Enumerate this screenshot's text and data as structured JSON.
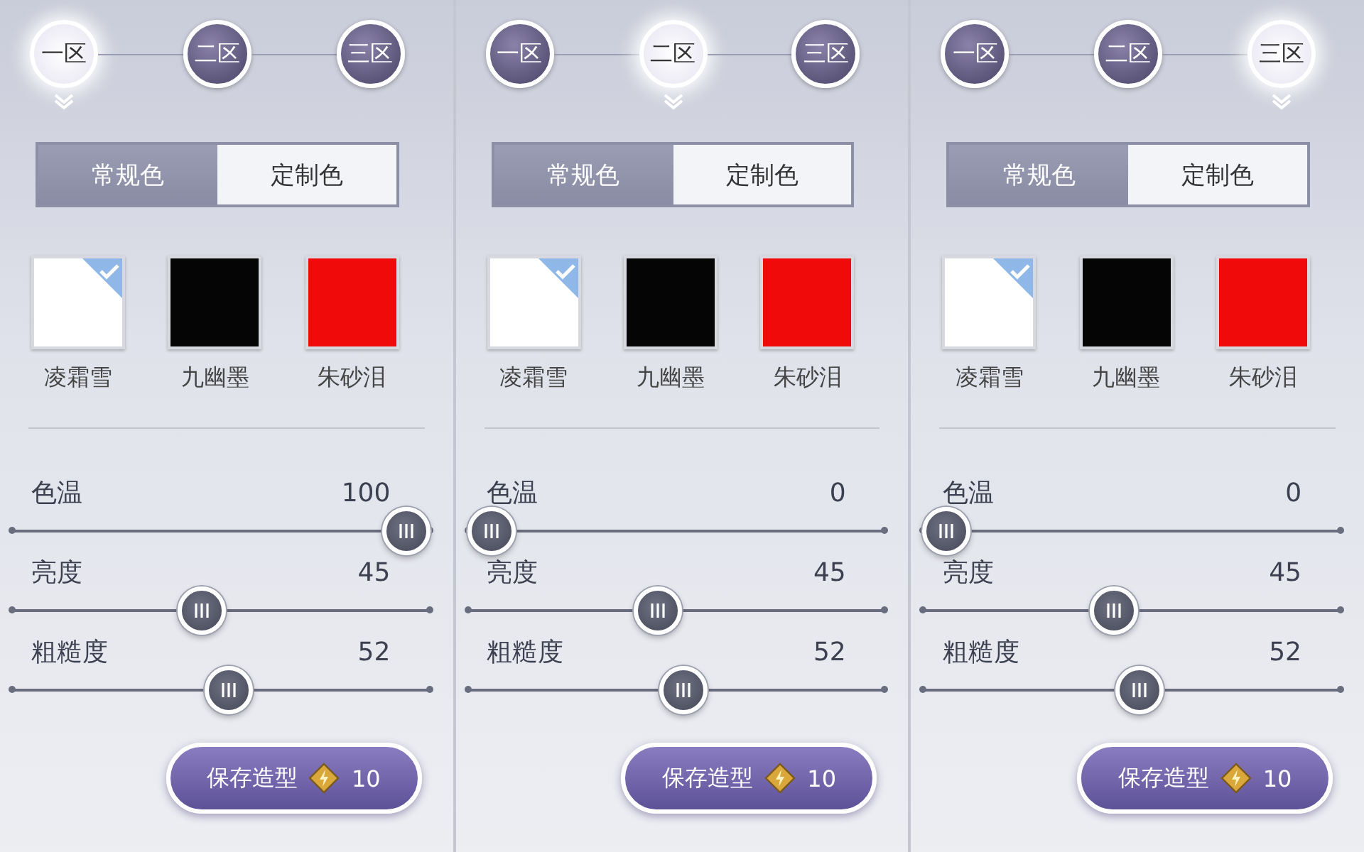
{
  "panels": [
    {
      "zones": [
        {
          "label": "一区",
          "selected": true
        },
        {
          "label": "二区",
          "selected": false
        },
        {
          "label": "三区",
          "selected": false
        }
      ],
      "modes": [
        {
          "label": "常规色",
          "selected": true
        },
        {
          "label": "定制色",
          "selected": false
        }
      ],
      "swatches": [
        {
          "label": "凌霜雪",
          "color": "#ffffff",
          "selected": true
        },
        {
          "label": "九幽墨",
          "color": "#050505",
          "selected": false
        },
        {
          "label": "朱砂泪",
          "color": "#f00a0a",
          "selected": false
        }
      ],
      "sliders": [
        {
          "label": "色温",
          "value": "100",
          "level": 1
        },
        {
          "label": "亮度",
          "value": "45",
          "level": 0.45
        },
        {
          "label": "粗糙度",
          "value": "52",
          "level": 0.52
        }
      ],
      "save": {
        "label": "保存造型",
        "cost": "10"
      }
    },
    {
      "zones": [
        {
          "label": "一区",
          "selected": false
        },
        {
          "label": "二区",
          "selected": true
        },
        {
          "label": "三区",
          "selected": false
        }
      ],
      "modes": [
        {
          "label": "常规色",
          "selected": true
        },
        {
          "label": "定制色",
          "selected": false
        }
      ],
      "swatches": [
        {
          "label": "凌霜雪",
          "color": "#ffffff",
          "selected": true
        },
        {
          "label": "九幽墨",
          "color": "#050505",
          "selected": false
        },
        {
          "label": "朱砂泪",
          "color": "#f00a0a",
          "selected": false
        }
      ],
      "sliders": [
        {
          "label": "色温",
          "value": "0",
          "level": 0
        },
        {
          "label": "亮度",
          "value": "45",
          "level": 0.45
        },
        {
          "label": "粗糙度",
          "value": "52",
          "level": 0.52
        }
      ],
      "save": {
        "label": "保存造型",
        "cost": "10"
      }
    },
    {
      "zones": [
        {
          "label": "一区",
          "selected": false
        },
        {
          "label": "二区",
          "selected": false
        },
        {
          "label": "三区",
          "selected": true
        }
      ],
      "modes": [
        {
          "label": "常规色",
          "selected": true
        },
        {
          "label": "定制色",
          "selected": false
        }
      ],
      "swatches": [
        {
          "label": "凌霜雪",
          "color": "#ffffff",
          "selected": true
        },
        {
          "label": "九幽墨",
          "color": "#050505",
          "selected": false
        },
        {
          "label": "朱砂泪",
          "color": "#f00a0a",
          "selected": false
        }
      ],
      "sliders": [
        {
          "label": "色温",
          "value": "0",
          "level": 0
        },
        {
          "label": "亮度",
          "value": "45",
          "level": 0.45
        },
        {
          "label": "粗糙度",
          "value": "52",
          "level": 0.52
        }
      ],
      "save": {
        "label": "保存造型",
        "cost": "10"
      }
    }
  ]
}
